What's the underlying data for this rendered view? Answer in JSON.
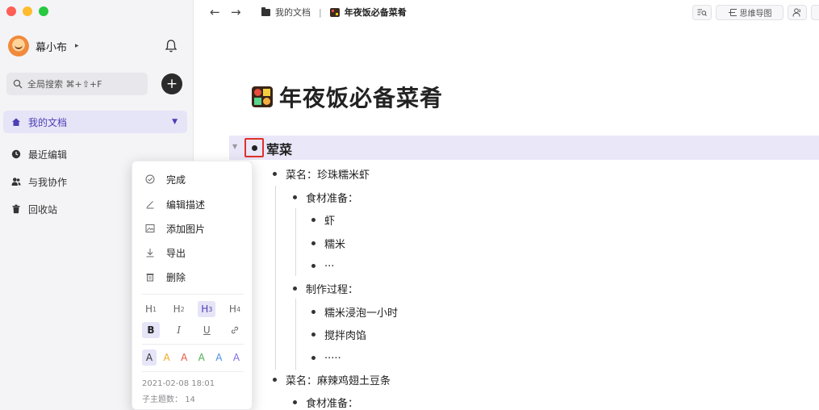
{
  "sidebar": {
    "user_name": "幕小布",
    "search_placeholder": "全局搜索 ⌘+⇧+F",
    "nav": [
      {
        "label": "我的文档",
        "icon": "home-icon"
      },
      {
        "label": "最近编辑",
        "icon": "clock-icon"
      },
      {
        "label": "与我协作",
        "icon": "people-icon"
      },
      {
        "label": "回收站",
        "icon": "trash-icon"
      }
    ]
  },
  "topbar": {
    "breadcrumb_root": "我的文档",
    "breadcrumb_current": "年夜饭必备菜肴",
    "mindmap_label": "思维导图"
  },
  "doc": {
    "title": "年夜饭必备菜肴",
    "outline": {
      "h1": "荤菜",
      "items": [
        {
          "text": "菜名：珍珠糯米虾"
        },
        {
          "text": "食材准备："
        },
        {
          "text": "虾"
        },
        {
          "text": "糯米"
        },
        {
          "text": "..."
        },
        {
          "text": "制作过程："
        },
        {
          "text": "糯米浸泡一小时"
        },
        {
          "text": "搅拌肉馅"
        },
        {
          "text": "....."
        },
        {
          "text": "菜名：麻辣鸡翅土豆条"
        },
        {
          "text": "食材准备："
        }
      ]
    }
  },
  "menu": {
    "items": [
      {
        "label": "完成",
        "icon": "check-circle-icon"
      },
      {
        "label": "编辑描述",
        "icon": "pen-icon"
      },
      {
        "label": "添加图片",
        "icon": "image-icon"
      },
      {
        "label": "导出",
        "icon": "download-icon"
      },
      {
        "label": "删除",
        "icon": "trash-icon"
      }
    ],
    "headings": [
      "H",
      "H",
      "H",
      "H"
    ],
    "heading_subs": [
      "1",
      "2",
      "3",
      "4"
    ],
    "format": [
      "B",
      "I",
      "U"
    ],
    "colors": [
      "#333333",
      "#f5a623",
      "#e9573f",
      "#4caf50",
      "#4a90e2",
      "#7e6ee0"
    ],
    "color_letter": "A",
    "timestamp": "2021-02-08 18:01",
    "subtopics_label": "子主题数：",
    "subtopics_count": "14"
  }
}
